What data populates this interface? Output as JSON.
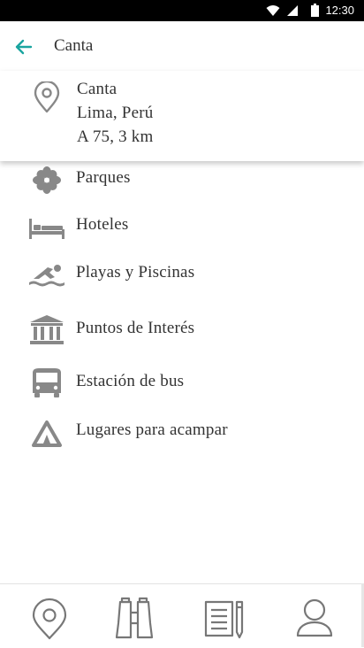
{
  "status_bar": {
    "time": "12:30",
    "icons": [
      "wifi-icon",
      "signal-icon",
      "battery-icon"
    ]
  },
  "app_bar": {
    "title": "Canta",
    "back_icon": "arrow-left-icon",
    "accent_color": "#1aa5a0"
  },
  "location_card": {
    "icon": "map-pin-icon",
    "name": "Canta",
    "region": "Lima, Perú",
    "distance": "A 75, 3 km"
  },
  "categories": [
    {
      "label": "Parques",
      "icon": "flower-icon"
    },
    {
      "label": "Hoteles",
      "icon": "bed-icon"
    },
    {
      "label": "Playas y Piscinas",
      "icon": "swimmer-icon"
    },
    {
      "label": "Puntos de Interés",
      "icon": "landmark-icon"
    },
    {
      "label": "Estación de bus",
      "icon": "bus-icon"
    },
    {
      "label": "Lugares para acampar",
      "icon": "tent-icon"
    }
  ],
  "bottom_nav": {
    "items": [
      "map-pin-nav-icon",
      "binoculars-icon",
      "notes-icon",
      "user-icon"
    ]
  },
  "colors": {
    "icon_gray": "#888888",
    "nav_icon_gray": "#777777",
    "text": "#333333"
  }
}
